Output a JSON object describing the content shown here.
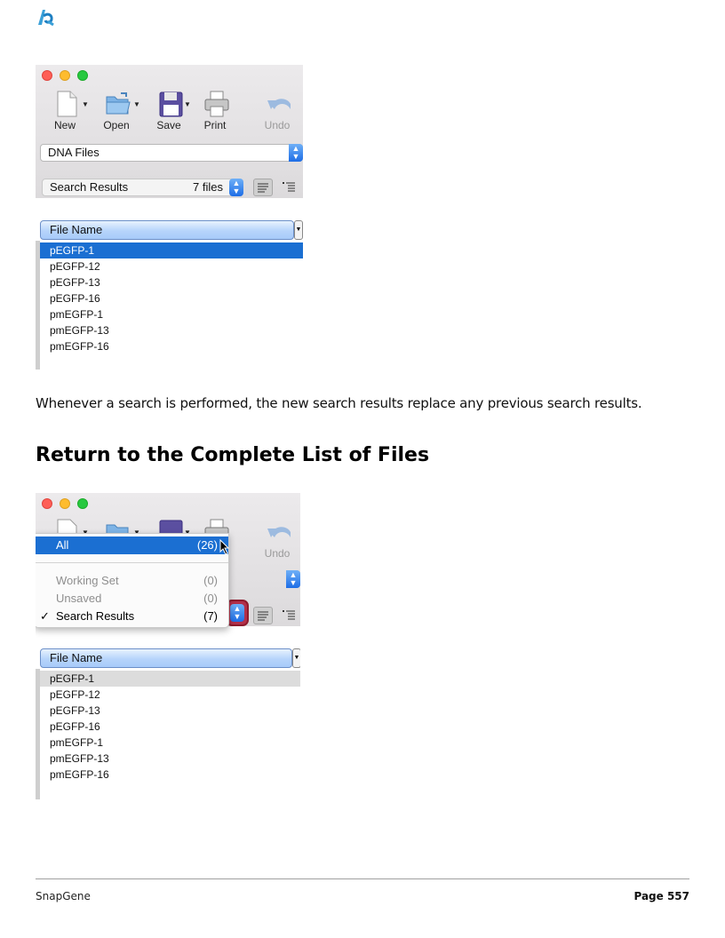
{
  "screenshot1": {
    "toolbar": [
      {
        "label": "New",
        "icon": "new-document-icon",
        "dim": false
      },
      {
        "label": "Open",
        "icon": "folder-icon",
        "dim": false
      },
      {
        "label": "Save",
        "icon": "floppy-disk-icon",
        "dim": false
      },
      {
        "label": "Print",
        "icon": "printer-icon",
        "dim": false
      },
      {
        "label": "Undo",
        "icon": "undo-arrow-icon",
        "dim": true
      }
    ],
    "collection": "DNA Files",
    "search_set": "Search Results",
    "search_count": "7 files",
    "column_header": "File Name",
    "files": [
      "pEGFP-1",
      "pEGFP-12",
      "pEGFP-13",
      "pEGFP-16",
      "pmEGFP-1",
      "pmEGFP-13",
      "pmEGFP-16"
    ],
    "selected_file": "pEGFP-1"
  },
  "paragraph": "Whenever a search is performed, the new search results replace any previous search results.",
  "heading": "Return to the Complete List of Files",
  "screenshot2": {
    "undo_label": "Undo",
    "menu": [
      {
        "name": "All",
        "count": "(26)",
        "state": "highlighted"
      },
      {
        "name": "Working Set",
        "count": "(0)",
        "state": "disabled"
      },
      {
        "name": "Unsaved",
        "count": "(0)",
        "state": "disabled"
      },
      {
        "name": "Search Results",
        "count": "(7)",
        "state": "checked"
      }
    ],
    "checkmark": "✓",
    "column_header": "File Name",
    "files": [
      "pEGFP-1",
      "pEGFP-12",
      "pEGFP-13",
      "pEGFP-16",
      "pmEGFP-1",
      "pmEGFP-13",
      "pmEGFP-16"
    ]
  },
  "footer": {
    "left": "SnapGene",
    "right": "Page 557"
  },
  "colors": {
    "selection": "#1b6fd2",
    "highlight_ring": "#8e1b2d",
    "accent_blue": "#1e6de6"
  }
}
